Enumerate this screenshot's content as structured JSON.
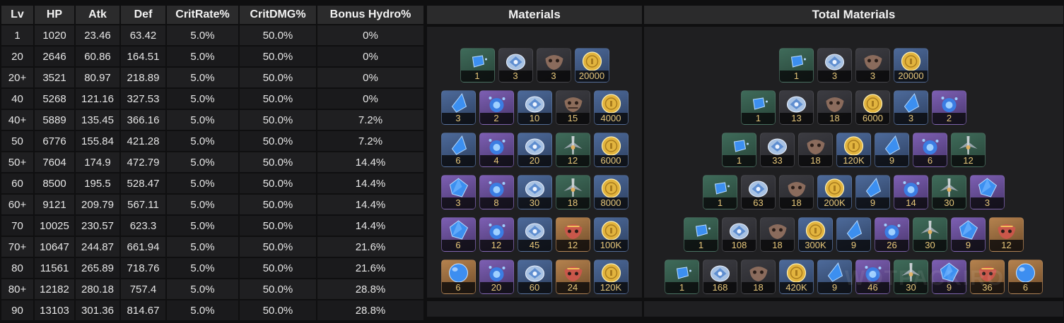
{
  "columns": {
    "lv": "Lv",
    "hp": "HP",
    "atk": "Atk",
    "def": "Def",
    "crit_rate": "CritRate%",
    "crit_dmg": "CritDMG%",
    "bonus": "Bonus Hydro%",
    "materials": "Materials",
    "total_materials": "Total Materials"
  },
  "rows": [
    {
      "lv": "1",
      "hp": "1020",
      "atk": "23.46",
      "def": "63.42",
      "cr": "5.0%",
      "cd": "50.0%",
      "bonus": "0%"
    },
    {
      "lv": "20",
      "hp": "2646",
      "atk": "60.86",
      "def": "164.51",
      "cr": "5.0%",
      "cd": "50.0%",
      "bonus": "0%"
    },
    {
      "lv": "20+",
      "hp": "3521",
      "atk": "80.97",
      "def": "218.89",
      "cr": "5.0%",
      "cd": "50.0%",
      "bonus": "0%"
    },
    {
      "lv": "40",
      "hp": "5268",
      "atk": "121.16",
      "def": "327.53",
      "cr": "5.0%",
      "cd": "50.0%",
      "bonus": "0%"
    },
    {
      "lv": "40+",
      "hp": "5889",
      "atk": "135.45",
      "def": "366.16",
      "cr": "5.0%",
      "cd": "50.0%",
      "bonus": "7.2%"
    },
    {
      "lv": "50",
      "hp": "6776",
      "atk": "155.84",
      "def": "421.28",
      "cr": "5.0%",
      "cd": "50.0%",
      "bonus": "7.2%"
    },
    {
      "lv": "50+",
      "hp": "7604",
      "atk": "174.9",
      "def": "472.79",
      "cr": "5.0%",
      "cd": "50.0%",
      "bonus": "14.4%"
    },
    {
      "lv": "60",
      "hp": "8500",
      "atk": "195.5",
      "def": "528.47",
      "cr": "5.0%",
      "cd": "50.0%",
      "bonus": "14.4%"
    },
    {
      "lv": "60+",
      "hp": "9121",
      "atk": "209.79",
      "def": "567.11",
      "cr": "5.0%",
      "cd": "50.0%",
      "bonus": "14.4%"
    },
    {
      "lv": "70",
      "hp": "10025",
      "atk": "230.57",
      "def": "623.3",
      "cr": "5.0%",
      "cd": "50.0%",
      "bonus": "14.4%"
    },
    {
      "lv": "70+",
      "hp": "10647",
      "atk": "244.87",
      "def": "661.94",
      "cr": "5.0%",
      "cd": "50.0%",
      "bonus": "21.6%"
    },
    {
      "lv": "80",
      "hp": "11561",
      "atk": "265.89",
      "def": "718.76",
      "cr": "5.0%",
      "cd": "50.0%",
      "bonus": "21.6%"
    },
    {
      "lv": "80+",
      "hp": "12182",
      "atk": "280.18",
      "def": "757.4",
      "cr": "5.0%",
      "cd": "50.0%",
      "bonus": "28.8%"
    },
    {
      "lv": "90",
      "hp": "13103",
      "atk": "301.36",
      "def": "814.67",
      "cr": "5.0%",
      "cd": "50.0%",
      "bonus": "28.8%"
    }
  ],
  "ascensions": [
    {
      "materials": [
        {
          "icon": "hydro-gem-sliver-icon",
          "rarity": "green",
          "count": "1"
        },
        {
          "icon": "dew-of-repudiation-icon",
          "rarity": "none",
          "count": "3"
        },
        {
          "icon": "mask-common-icon",
          "rarity": "none",
          "count": "3"
        },
        {
          "icon": "mora-icon",
          "rarity": "blue",
          "count": "20000"
        }
      ],
      "totals": [
        {
          "icon": "hydro-gem-sliver-icon",
          "rarity": "green",
          "count": "1"
        },
        {
          "icon": "dew-of-repudiation-icon",
          "rarity": "none",
          "count": "3"
        },
        {
          "icon": "mask-common-icon",
          "rarity": "none",
          "count": "3"
        },
        {
          "icon": "mora-icon",
          "rarity": "blue",
          "count": "20000"
        }
      ]
    },
    {
      "materials": [
        {
          "icon": "hydro-gem-fragment-icon",
          "rarity": "blue",
          "count": "3"
        },
        {
          "icon": "water-boss-drop-icon",
          "rarity": "purple",
          "count": "2"
        },
        {
          "icon": "dew-of-repudiation-icon",
          "rarity": "blue",
          "count": "10"
        },
        {
          "icon": "mask-stained-icon",
          "rarity": "none",
          "count": "15"
        },
        {
          "icon": "mora-icon",
          "rarity": "blue",
          "count": "4000"
        }
      ],
      "totals": [
        {
          "icon": "hydro-gem-sliver-icon",
          "rarity": "green",
          "count": "1"
        },
        {
          "icon": "dew-of-repudiation-icon",
          "rarity": "none",
          "count": "13"
        },
        {
          "icon": "mask-common-icon",
          "rarity": "none",
          "count": "18"
        },
        {
          "icon": "mora-icon",
          "rarity": "none",
          "count": "6000"
        },
        {
          "icon": "hydro-gem-fragment-icon",
          "rarity": "blue",
          "count": "3"
        },
        {
          "icon": "water-boss-drop-icon",
          "rarity": "purple",
          "count": "2"
        }
      ]
    },
    {
      "materials": [
        {
          "icon": "hydro-gem-fragment-icon",
          "rarity": "blue",
          "count": "6"
        },
        {
          "icon": "water-boss-drop-icon",
          "rarity": "purple",
          "count": "4"
        },
        {
          "icon": "dew-of-repudiation-icon",
          "rarity": "blue",
          "count": "20"
        },
        {
          "icon": "hilt-icon",
          "rarity": "green",
          "count": "12"
        },
        {
          "icon": "mora-icon",
          "rarity": "blue",
          "count": "6000"
        }
      ],
      "totals": [
        {
          "icon": "hydro-gem-sliver-icon",
          "rarity": "green",
          "count": "1"
        },
        {
          "icon": "dew-of-repudiation-icon",
          "rarity": "none",
          "count": "33"
        },
        {
          "icon": "mask-common-icon",
          "rarity": "none",
          "count": "18"
        },
        {
          "icon": "mora-icon",
          "rarity": "blue",
          "count": "120K"
        },
        {
          "icon": "hydro-gem-fragment-icon",
          "rarity": "blue",
          "count": "9"
        },
        {
          "icon": "water-boss-drop-icon",
          "rarity": "purple",
          "count": "6"
        },
        {
          "icon": "hilt-icon",
          "rarity": "green",
          "count": "12"
        }
      ]
    },
    {
      "materials": [
        {
          "icon": "hydro-gem-chunk-icon",
          "rarity": "purple",
          "count": "3"
        },
        {
          "icon": "water-boss-drop-icon",
          "rarity": "purple",
          "count": "8"
        },
        {
          "icon": "dew-of-repudiation-icon",
          "rarity": "blue",
          "count": "30"
        },
        {
          "icon": "hilt-icon",
          "rarity": "green",
          "count": "18"
        },
        {
          "icon": "mora-icon",
          "rarity": "blue",
          "count": "8000"
        }
      ],
      "totals": [
        {
          "icon": "hydro-gem-sliver-icon",
          "rarity": "green",
          "count": "1"
        },
        {
          "icon": "dew-of-repudiation-icon",
          "rarity": "none",
          "count": "63"
        },
        {
          "icon": "mask-common-icon",
          "rarity": "none",
          "count": "18"
        },
        {
          "icon": "mora-icon",
          "rarity": "blue",
          "count": "200K"
        },
        {
          "icon": "hydro-gem-fragment-icon",
          "rarity": "blue",
          "count": "9"
        },
        {
          "icon": "water-boss-drop-icon",
          "rarity": "purple",
          "count": "14"
        },
        {
          "icon": "hilt-icon",
          "rarity": "green",
          "count": "30"
        },
        {
          "icon": "hydro-gem-chunk-icon",
          "rarity": "purple",
          "count": "3"
        }
      ]
    },
    {
      "materials": [
        {
          "icon": "hydro-gem-chunk-icon",
          "rarity": "purple",
          "count": "6"
        },
        {
          "icon": "water-boss-drop-icon",
          "rarity": "purple",
          "count": "12"
        },
        {
          "icon": "dew-of-repudiation-icon",
          "rarity": "blue",
          "count": "45"
        },
        {
          "icon": "mask-ominous-icon",
          "rarity": "gold",
          "count": "12"
        },
        {
          "icon": "mora-icon",
          "rarity": "blue",
          "count": "100K"
        }
      ],
      "totals": [
        {
          "icon": "hydro-gem-sliver-icon",
          "rarity": "green",
          "count": "1"
        },
        {
          "icon": "dew-of-repudiation-icon",
          "rarity": "none",
          "count": "108"
        },
        {
          "icon": "mask-common-icon",
          "rarity": "none",
          "count": "18"
        },
        {
          "icon": "mora-icon",
          "rarity": "blue",
          "count": "300K"
        },
        {
          "icon": "hydro-gem-fragment-icon",
          "rarity": "blue",
          "count": "9"
        },
        {
          "icon": "water-boss-drop-icon",
          "rarity": "purple",
          "count": "26"
        },
        {
          "icon": "hilt-icon",
          "rarity": "green",
          "count": "30"
        },
        {
          "icon": "hydro-gem-chunk-icon",
          "rarity": "purple",
          "count": "9"
        },
        {
          "icon": "mask-ominous-icon",
          "rarity": "gold",
          "count": "12"
        }
      ]
    },
    {
      "materials": [
        {
          "icon": "hydro-gem-icon",
          "rarity": "gold",
          "count": "6"
        },
        {
          "icon": "water-boss-drop-icon",
          "rarity": "purple",
          "count": "20"
        },
        {
          "icon": "dew-of-repudiation-icon",
          "rarity": "blue",
          "count": "60"
        },
        {
          "icon": "mask-ominous-icon",
          "rarity": "gold",
          "count": "24"
        },
        {
          "icon": "mora-icon",
          "rarity": "blue",
          "count": "120K"
        }
      ],
      "totals": [
        {
          "icon": "hydro-gem-sliver-icon",
          "rarity": "green",
          "count": "1"
        },
        {
          "icon": "dew-of-repudiation-icon",
          "rarity": "none",
          "count": "168"
        },
        {
          "icon": "mask-common-icon",
          "rarity": "none",
          "count": "18"
        },
        {
          "icon": "mora-icon",
          "rarity": "blue",
          "count": "420K"
        },
        {
          "icon": "hydro-gem-fragment-icon",
          "rarity": "blue",
          "count": "9"
        },
        {
          "icon": "water-boss-drop-icon",
          "rarity": "purple",
          "count": "46"
        },
        {
          "icon": "hilt-icon",
          "rarity": "green",
          "count": "30"
        },
        {
          "icon": "hydro-gem-chunk-icon",
          "rarity": "purple",
          "count": "9"
        },
        {
          "icon": "mask-ominous-icon",
          "rarity": "gold",
          "count": "36"
        },
        {
          "icon": "hydro-gem-icon",
          "rarity": "gold",
          "count": "6"
        }
      ]
    }
  ],
  "watermark": "WOTPACKIRO",
  "colors": {
    "background": "#0f0f10",
    "header_bg": "#2b2b2c",
    "cell_bg": "#1f1f21",
    "count_text": "#e7c77a",
    "rarity_green": "#3f6b5a",
    "rarity_blue": "#4d6a9a",
    "rarity_purple": "#7d5fb3",
    "rarity_gold": "#b5824e"
  }
}
